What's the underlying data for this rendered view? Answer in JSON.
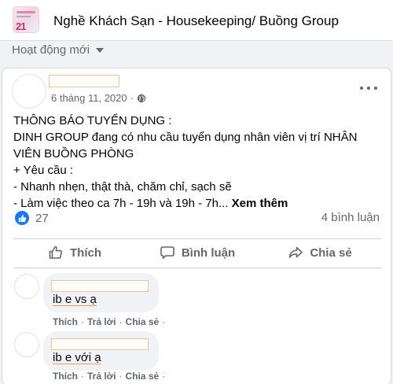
{
  "group": {
    "name": "Nghề Khách Sạn - Housekeeping/ Buồng Group"
  },
  "sort": {
    "label": "Hoạt động mới"
  },
  "post": {
    "date": "6 tháng 11, 2020",
    "dot": "·",
    "lines": [
      "THÔNG BÁO TUYỂN DỤNG :",
      "DINH GROUP đang có nhu cầu tuyển dụng nhân viên vị trí NHÂN",
      "VIÊN BUỒNG PHÒNG",
      "+ Yêu cầu :",
      "- Nhanh nhẹn, thật thà, chăm chỉ, sạch sẽ",
      "- Làm việc theo ca 7h - 19h và 19h - 7h..."
    ],
    "see_more": "Xem thêm",
    "like_count": "27",
    "comment_count": "4 bình luận"
  },
  "actions": {
    "like": "Thích",
    "comment": "Bình luận",
    "share": "Chia sẻ"
  },
  "comments": [
    {
      "text": "ib e vs ạ",
      "actions": [
        "Thích",
        "Trả lời",
        "Chia sẻ"
      ]
    },
    {
      "text": "ib e với ạ",
      "actions": [
        "Thích",
        "Trả lời",
        "Chia sẻ"
      ]
    }
  ],
  "colors": {
    "accent": "#1877f2",
    "secondary_text": "#65676b",
    "name_placeholder_border": "#e9c596"
  }
}
